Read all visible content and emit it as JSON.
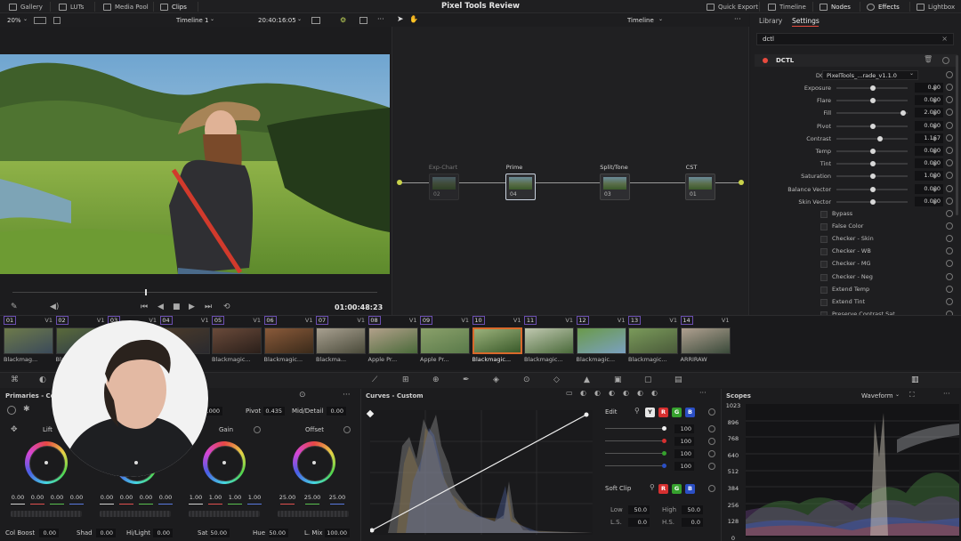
{
  "topbar": {
    "gallery": "Gallery",
    "luts": "LUTs",
    "media_pool": "Media Pool",
    "clips": "Clips",
    "project_title": "Pixel Tools Review",
    "quick_export": "Quick Export",
    "timeline": "Timeline",
    "nodes": "Nodes",
    "effects": "Effects",
    "lightbox": "Lightbox"
  },
  "viewer_header": {
    "zoom": "20%",
    "timeline_name": "Timeline 1",
    "timecode": "20:40:16:05",
    "node_mode": "Timeline"
  },
  "transport": {
    "timecode": "01:00:48:23"
  },
  "nodes": [
    {
      "name": "Exp-Chart",
      "num": "02"
    },
    {
      "name": "Prime",
      "num": "04"
    },
    {
      "name": "Split/Tone",
      "num": "03"
    },
    {
      "name": "CST",
      "num": "01"
    }
  ],
  "settings_panel": {
    "tab_library": "Library",
    "tab_settings": "Settings",
    "search_value": "dctl",
    "effect_name": "DCTL",
    "dctl_label": "DCTL",
    "dctl_value": "PixelTools_...rade_v1.1.0",
    "params": [
      {
        "label": "Exposure",
        "value": "0.00",
        "pos": 0.5
      },
      {
        "label": "Flare",
        "value": "0.000",
        "pos": 0.5
      },
      {
        "label": "Fill",
        "value": "2.000",
        "pos": 0.95
      },
      {
        "label": "Pivot",
        "value": "0.000",
        "pos": 0.5
      },
      {
        "label": "Contrast",
        "value": "1.167",
        "pos": 0.6
      },
      {
        "label": "Temp",
        "value": "0.000",
        "pos": 0.5
      },
      {
        "label": "Tint",
        "value": "0.000",
        "pos": 0.5
      },
      {
        "label": "Saturation",
        "value": "1.000",
        "pos": 0.5
      },
      {
        "label": "Balance Vector",
        "value": "0.000",
        "pos": 0.5
      },
      {
        "label": "Skin Vector",
        "value": "0.000",
        "pos": 0.5
      }
    ],
    "checkboxes": [
      "Bypass",
      "False Color",
      "Checker - Skin",
      "Checker - WB",
      "Checker - MG",
      "Checker - Neg",
      "Extend Temp",
      "Extend Tint",
      "Preserve Contrast Sat"
    ]
  },
  "clips": [
    {
      "num": "01",
      "track": "V1",
      "name": "Blackmag..."
    },
    {
      "num": "02",
      "track": "V1",
      "name": "Blackmagic..."
    },
    {
      "num": "03",
      "track": "V1",
      "name": ""
    },
    {
      "num": "04",
      "track": "V1",
      "name": ""
    },
    {
      "num": "05",
      "track": "V1",
      "name": "Blackmagic..."
    },
    {
      "num": "06",
      "track": "V1",
      "name": "Blackmagic..."
    },
    {
      "num": "07",
      "track": "V1",
      "name": "Blackma..."
    },
    {
      "num": "08",
      "track": "V1",
      "name": "Apple Pr..."
    },
    {
      "num": "09",
      "track": "V1",
      "name": "Apple Pr..."
    },
    {
      "num": "10",
      "track": "V1",
      "name": "Blackmagic..."
    },
    {
      "num": "11",
      "track": "V1",
      "name": "Blackmagic..."
    },
    {
      "num": "12",
      "track": "V1",
      "name": "Blackmagic..."
    },
    {
      "num": "13",
      "track": "V1",
      "name": "Blackmagic..."
    },
    {
      "num": "14",
      "track": "V1",
      "name": "ARRIRAW"
    }
  ],
  "primaries": {
    "title": "Primaries - Co",
    "top_value": "0.000",
    "pivot_label": "Pivot",
    "pivot_value": "0.435",
    "middetail_label": "Mid/Detail",
    "middetail_value": "0.00",
    "lift_label": "Lift",
    "gain_label": "Gain",
    "offset_label": "Offset",
    "lift_values": [
      "0.00",
      "0.00",
      "0.00",
      "0.00"
    ],
    "gamma_values": [
      "0.00",
      "0.00",
      "0.00",
      "0.00"
    ],
    "gain_values": [
      "1.00",
      "1.00",
      "1.00",
      "1.00"
    ],
    "offset_values": [
      "25.00",
      "25.00",
      "25.00"
    ],
    "bottom": [
      {
        "label": "Col Boost",
        "value": "0.00"
      },
      {
        "label": "Shad",
        "value": "0.00"
      },
      {
        "label": "Hi/Light",
        "value": "0.00"
      },
      {
        "label": "Sat",
        "value": "50.00"
      },
      {
        "label": "Hue",
        "value": "50.00"
      },
      {
        "label": "L. Mix",
        "value": "100.00"
      }
    ]
  },
  "curves": {
    "title": "Curves - Custom",
    "edit_label": "Edit",
    "channels": [
      "Y",
      "R",
      "G",
      "B"
    ],
    "edit_values": [
      "100",
      "100",
      "100",
      "100"
    ],
    "soft_clip_label": "Soft Clip",
    "low_label": "Low",
    "low_value": "50.0",
    "high_label": "High",
    "high_value": "50.0",
    "ls_label": "L.S.",
    "ls_value": "0.0",
    "hs_label": "H.S.",
    "hs_value": "0.0"
  },
  "scopes": {
    "title": "Scopes",
    "mode": "Waveform",
    "ticks": [
      "1023",
      "896",
      "768",
      "640",
      "512",
      "384",
      "256",
      "128",
      "0"
    ]
  },
  "colors": {
    "accent_red": "#e84a3e",
    "clip_border": "#6b4fb1",
    "selected_clip": "#d9692b"
  }
}
